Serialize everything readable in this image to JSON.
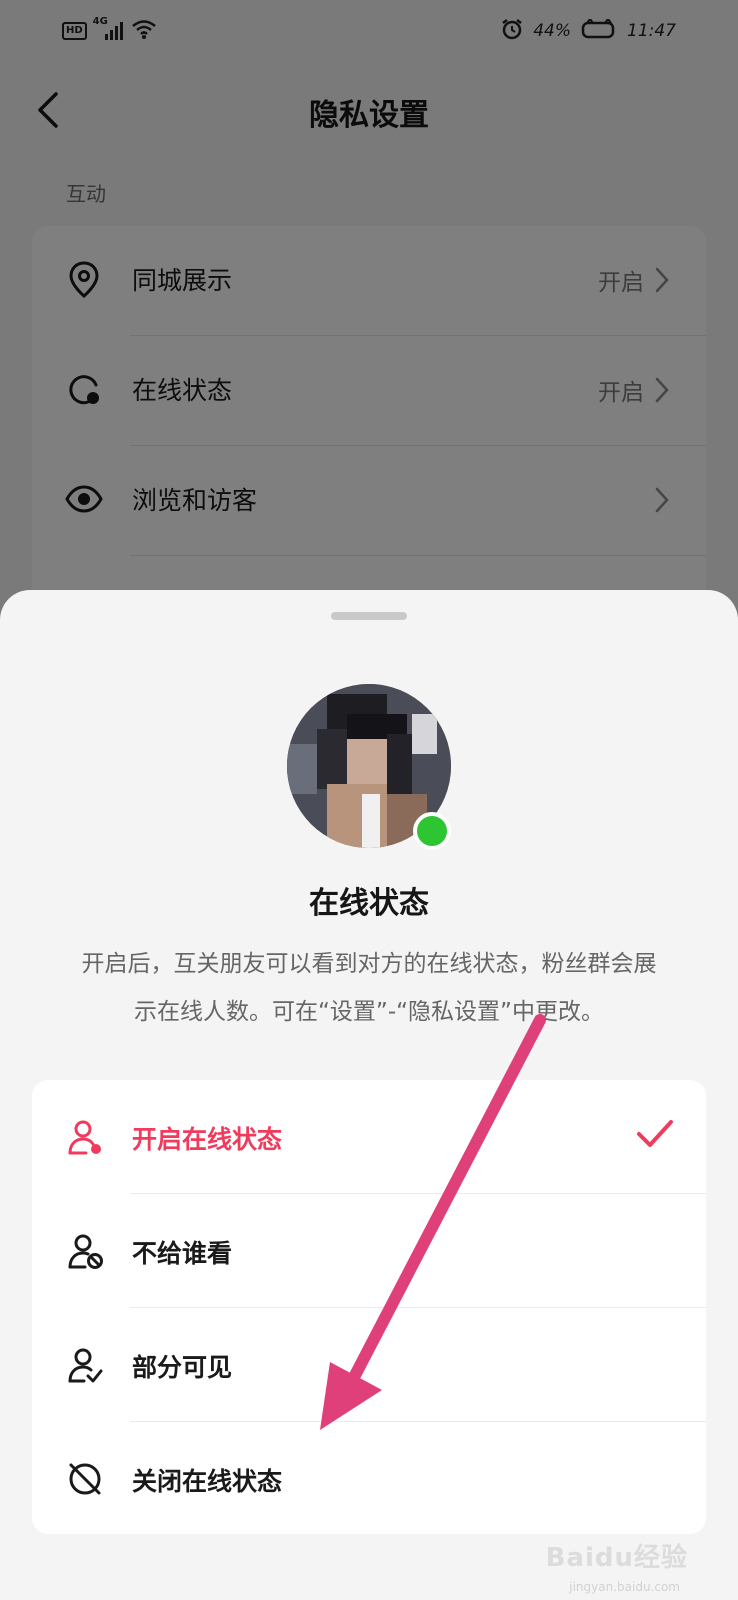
{
  "status_bar": {
    "hd": "HD",
    "network": "4G",
    "battery": "44%",
    "time": "11:47"
  },
  "nav": {
    "title": "隐私设置"
  },
  "section": {
    "label": "互动"
  },
  "settings": [
    {
      "label": "同城展示",
      "value": "开启",
      "icon": "location-pin-icon"
    },
    {
      "label": "在线状态",
      "value": "开启",
      "icon": "online-status-icon"
    },
    {
      "label": "浏览和访客",
      "value": "",
      "icon": "eye-icon"
    }
  ],
  "sheet": {
    "title": "在线状态",
    "description_line1": "开启后，互关朋友可以看到对方的在线状态，粉丝群会展",
    "description_line2": "示在线人数。可在“设置”-“隐私设置”中更改。",
    "options": [
      {
        "label": "开启在线状态",
        "selected": true,
        "icon": "person-online-icon"
      },
      {
        "label": "不给谁看",
        "selected": false,
        "icon": "person-block-icon"
      },
      {
        "label": "部分可见",
        "selected": false,
        "icon": "person-check-icon"
      },
      {
        "label": "关闭在线状态",
        "selected": false,
        "icon": "status-off-icon"
      }
    ]
  },
  "watermark": {
    "text": "Baidu经验",
    "sub": "jingyan.baidu.com"
  },
  "colors": {
    "accent": "#f03b5d",
    "online": "#2dc532",
    "annotation_arrow": "#e0407a"
  }
}
